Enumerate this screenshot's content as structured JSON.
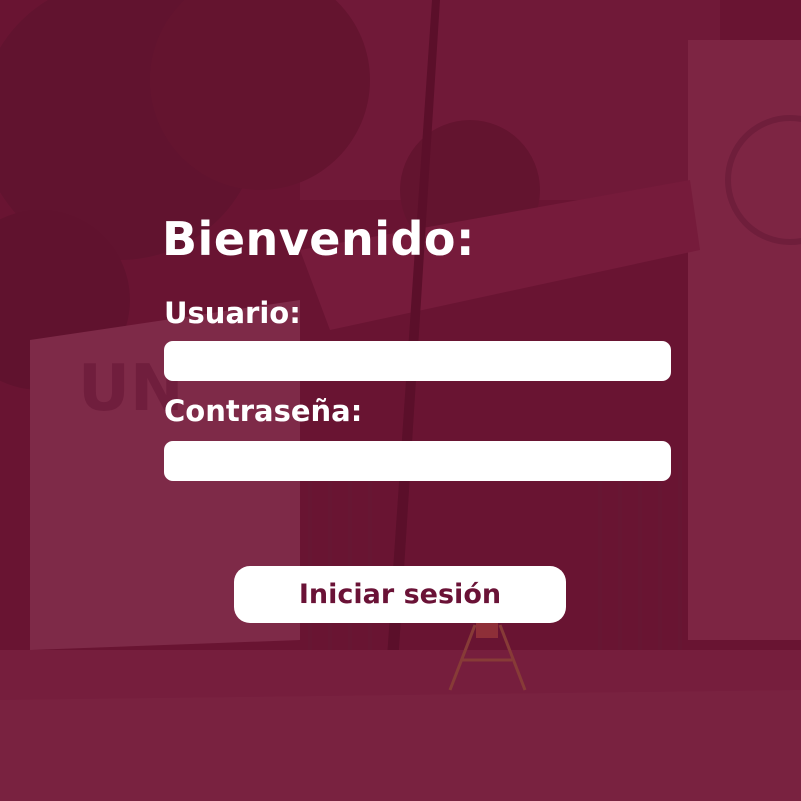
{
  "login": {
    "title": "Bienvenido:",
    "username": {
      "label": "Usuario:",
      "value": "",
      "placeholder": ""
    },
    "password": {
      "label": "Contraseña:",
      "value": "",
      "placeholder": ""
    },
    "submit_label": "Iniciar sesión"
  },
  "colors": {
    "overlay": "#731434",
    "button_text": "#6a1236",
    "field_background": "#ffffff"
  }
}
